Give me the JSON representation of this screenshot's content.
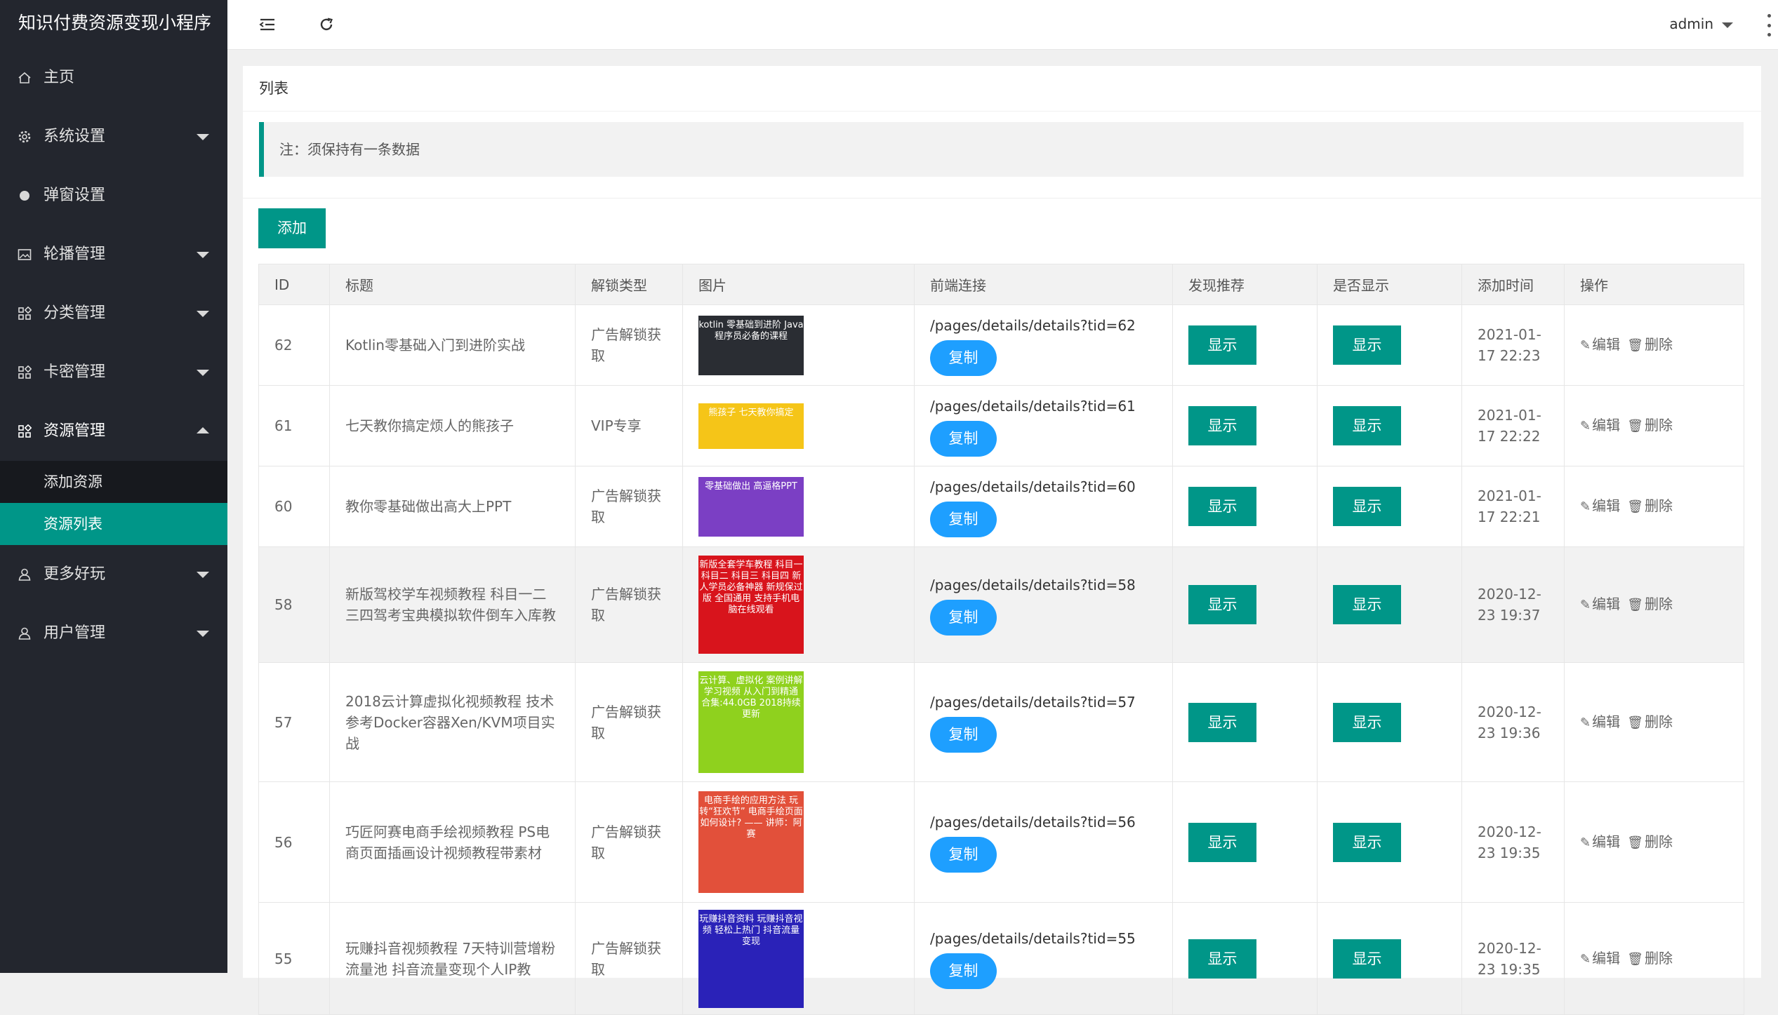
{
  "app": {
    "title": "知识付费资源变现小程序"
  },
  "sidebar": {
    "items": [
      {
        "label": "主页",
        "icon": "home-icon"
      },
      {
        "label": "系统设置",
        "icon": "gear-icon"
      },
      {
        "label": "弹窗设置",
        "icon": "dot-icon"
      },
      {
        "label": "轮播管理",
        "icon": "image-icon"
      },
      {
        "label": "分类管理",
        "icon": "apps-icon"
      },
      {
        "label": "卡密管理",
        "icon": "apps-icon"
      },
      {
        "label": "资源管理",
        "icon": "apps-icon"
      },
      {
        "label": "更多好玩",
        "icon": "user-icon"
      },
      {
        "label": "用户管理",
        "icon": "user-icon"
      }
    ],
    "submenu": [
      {
        "label": "添加资源"
      },
      {
        "label": "资源列表"
      }
    ]
  },
  "topbar": {
    "user": "admin"
  },
  "panel": {
    "title": "列表",
    "notice": "注：须保持有一条数据",
    "add_label": "添加"
  },
  "table": {
    "headers": [
      "ID",
      "标题",
      "解锁类型",
      "图片",
      "前端连接",
      "发现推荐",
      "是否显示",
      "添加时间",
      "操作"
    ],
    "copy_label": "复制",
    "show_label": "显示",
    "edit_label": "编辑",
    "delete_label": "删除",
    "rows": [
      {
        "id": "62",
        "title": "Kotlin零基础入门到进阶实战",
        "unlock": "广告解锁获取",
        "thumb_text": "kotlin 零基础到进阶 Java程序员必备的课程",
        "thumb_color": "#2a2d33",
        "link": "/pages/details/details?tid=62",
        "time": "2021-01-17 22:23"
      },
      {
        "id": "61",
        "title": "七天教你搞定烦人的熊孩子",
        "unlock": "VIP专享",
        "thumb_text": "熊孩子 七天教你搞定",
        "thumb_color": "#f5c518",
        "link": "/pages/details/details?tid=61",
        "time": "2021-01-17 22:22"
      },
      {
        "id": "60",
        "title": "教你零基础做出高大上PPT",
        "unlock": "广告解锁获取",
        "thumb_text": "零基础做出 高逼格PPT",
        "thumb_color": "#7b3fc4",
        "link": "/pages/details/details?tid=60",
        "time": "2021-01-17 22:21"
      },
      {
        "id": "58",
        "title": "新版驾校学车视频教程 科目一二三四驾考宝典模拟软件倒车入库教",
        "unlock": "广告解锁获取",
        "thumb_text": "新版全套学车教程 科目一 科目二 科目三 科目四 新人学员必备神器 新规保过版 全国通用 支持手机电脑在线观看",
        "thumb_color": "#d8141c",
        "link": "/pages/details/details?tid=58",
        "time": "2020-12-23 19:37"
      },
      {
        "id": "57",
        "title": "2018云计算虚拟化视频教程 技术参考Docker容器Xen/KVM项目实战",
        "unlock": "广告解锁获取",
        "thumb_text": "云计算、虚拟化 案例讲解学习视频 从入门到精通 合集:44.0GB 2018持续更新",
        "thumb_color": "#8fd11e",
        "link": "/pages/details/details?tid=57",
        "time": "2020-12-23 19:36"
      },
      {
        "id": "56",
        "title": "巧匠阿赛电商手绘视频教程 PS电商页面插画设计视频教程带素材",
        "unlock": "广告解锁获取",
        "thumb_text": "电商手绘的应用方法 玩转“狂欢节” 电商手绘页面如何设计? —— 讲师：阿赛",
        "thumb_color": "#e2503a",
        "link": "/pages/details/details?tid=56",
        "time": "2020-12-23 19:35"
      },
      {
        "id": "55",
        "title": "玩赚抖音视频教程 7天特训营增粉流量池 抖音流量变现个人IP教",
        "unlock": "广告解锁获取",
        "thumb_text": "玩赚抖音资料 玩赚抖音视频 轻松上热门 抖音流量变现",
        "thumb_color": "#2a22b8",
        "link": "/pages/details/details?tid=55",
        "time": "2020-12-23 19:35"
      }
    ]
  }
}
